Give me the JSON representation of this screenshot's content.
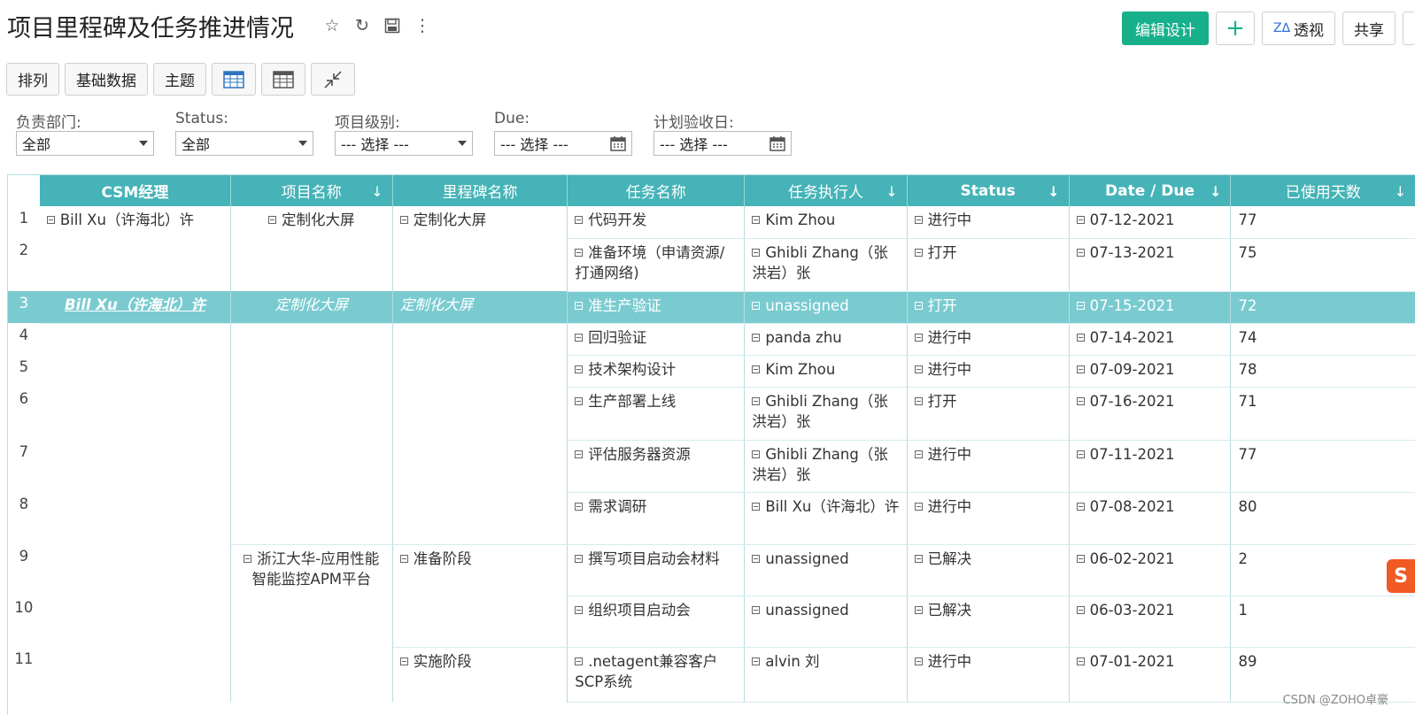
{
  "page": {
    "title": "项目里程碑及任务推进情况",
    "icons": [
      "star-icon",
      "refresh-icon",
      "save-icon",
      "more-icon"
    ]
  },
  "actions": {
    "edit_design": "编辑设计",
    "add": "+",
    "pivot": "透视",
    "share": "共享"
  },
  "toolbar": {
    "arrange": "排列",
    "base_data": "基础数据",
    "theme": "主题"
  },
  "filters": [
    {
      "label": "负责部门:",
      "value": "全部",
      "kind": "select"
    },
    {
      "label": "Status:",
      "value": "全部",
      "kind": "select"
    },
    {
      "label": "项目级别:",
      "value": "--- 选择 ---",
      "kind": "select"
    },
    {
      "label": "Due:",
      "value": "--- 选择 ---",
      "kind": "date"
    },
    {
      "label": "计划验收日:",
      "value": "--- 选择 ---",
      "kind": "date"
    }
  ],
  "table": {
    "columns": [
      "CSM经理",
      "项目名称",
      "里程碑名称",
      "任务名称",
      "任务执行人",
      "Status",
      "Date / Due",
      "已使用天数"
    ],
    "rows": [
      {
        "n": "1",
        "csm": "Bill Xu（许海北）许",
        "project": "定制化大屏",
        "milestone": "定制化大屏",
        "task": "代码开发",
        "assignee": "Kim Zhou",
        "status": "进行中",
        "date": "07-12-2021",
        "days": "77"
      },
      {
        "n": "2",
        "task": "准备环境（申请资源/打通网络)",
        "assignee": "Ghibli Zhang（张洪岩）张",
        "status": "打开",
        "date": "07-13-2021",
        "days": "75"
      },
      {
        "n": "3",
        "csm": "Bill Xu（许海北）许",
        "project": "定制化大屏",
        "milestone": "定制化大屏",
        "task": "准生产验证",
        "assignee": "unassigned",
        "status": "打开",
        "date": "07-15-2021",
        "days": "72"
      },
      {
        "n": "4",
        "task": "回归验证",
        "assignee": "panda zhu",
        "status": "进行中",
        "date": "07-14-2021",
        "days": "74"
      },
      {
        "n": "5",
        "task": "技术架构设计",
        "assignee": "Kim Zhou",
        "status": "进行中",
        "date": "07-09-2021",
        "days": "78"
      },
      {
        "n": "6",
        "task": "生产部署上线",
        "assignee": "Ghibli Zhang（张洪岩）张",
        "status": "打开",
        "date": "07-16-2021",
        "days": "71"
      },
      {
        "n": "7",
        "task": "评估服务器资源",
        "assignee": "Ghibli Zhang（张洪岩）张",
        "status": "进行中",
        "date": "07-11-2021",
        "days": "77"
      },
      {
        "n": "8",
        "task": "需求调研",
        "assignee": "Bill Xu（许海北）许",
        "status": "进行中",
        "date": "07-08-2021",
        "days": "80"
      },
      {
        "n": "9",
        "project": "浙江大华-应用性能智能监控APM平台",
        "milestone": "准备阶段",
        "task": "撰写项目启动会材料",
        "assignee": "unassigned",
        "status": "已解决",
        "date": "06-02-2021",
        "days": "2"
      },
      {
        "n": "10",
        "task": "组织项目启动会",
        "assignee": "unassigned",
        "status": "已解决",
        "date": "06-03-2021",
        "days": "1"
      },
      {
        "n": "11",
        "milestone": "实施阶段",
        "task": ".netagent兼容客户SCP系统",
        "assignee": "alvin 刘",
        "status": "进行中",
        "date": "07-01-2021",
        "days": "89"
      }
    ]
  },
  "watermark": "CSDN @ZOHO卓豪"
}
